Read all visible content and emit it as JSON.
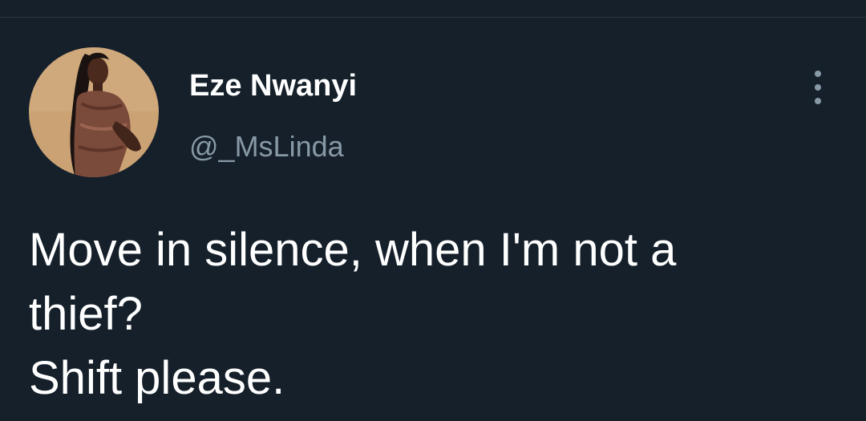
{
  "tweet": {
    "author": {
      "display_name": "Eze Nwanyi",
      "handle": "@_MsLinda",
      "avatar_icon": "profile-photo"
    },
    "more_icon": "more-vertical-icon",
    "text_lines": [
      "Move in silence, when I'm not a",
      "thief?",
      "Shift please."
    ]
  },
  "colors": {
    "background": "#15202b",
    "primary_text": "#ffffff",
    "secondary_text": "#8899a6",
    "divider": "#2b3744"
  }
}
